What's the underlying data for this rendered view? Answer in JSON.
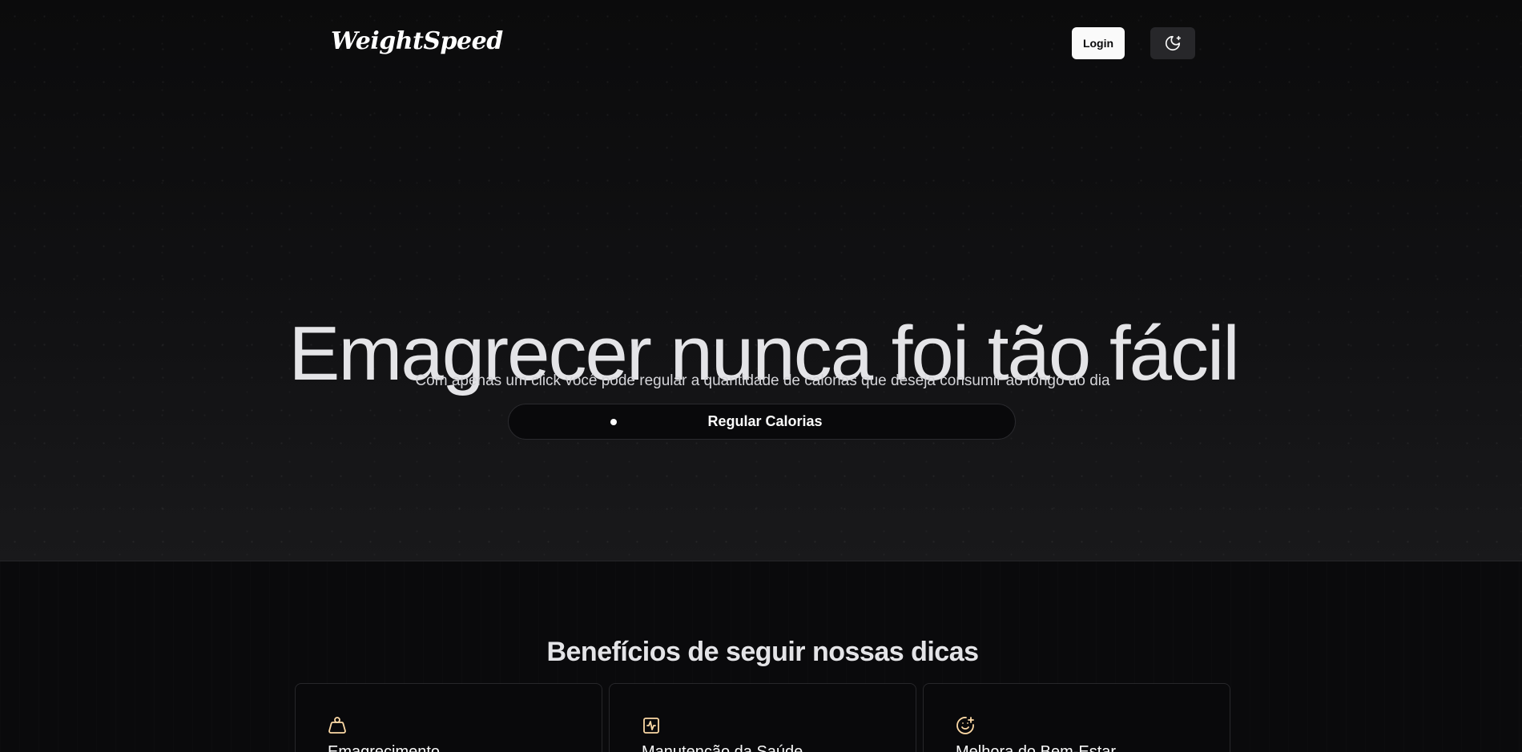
{
  "navbar": {
    "logo": "WeightSpeed",
    "login_label": "Login",
    "theme_icon": "moon-sparkles-icon"
  },
  "hero": {
    "title": "Emagrecer nunca foi tão fácil",
    "subtitle": "Com apenas um click você pode regular a quantidade de calorias que deseja consumir ao longo do dia",
    "cta_label": "Regular Calorias"
  },
  "benefits": {
    "title": "Benefícios de seguir nossas dicas",
    "cards": [
      {
        "icon": "weight-icon",
        "title": "Emagrecimento"
      },
      {
        "icon": "activity-square-icon",
        "title": "Manutenção da Saúde"
      },
      {
        "icon": "smile-plus-icon",
        "title": "Melhora do Bem-Estar"
      }
    ]
  },
  "colors": {
    "background": "#09090b",
    "accent_icon": "#fcd9a5",
    "text": "#fafafa"
  }
}
